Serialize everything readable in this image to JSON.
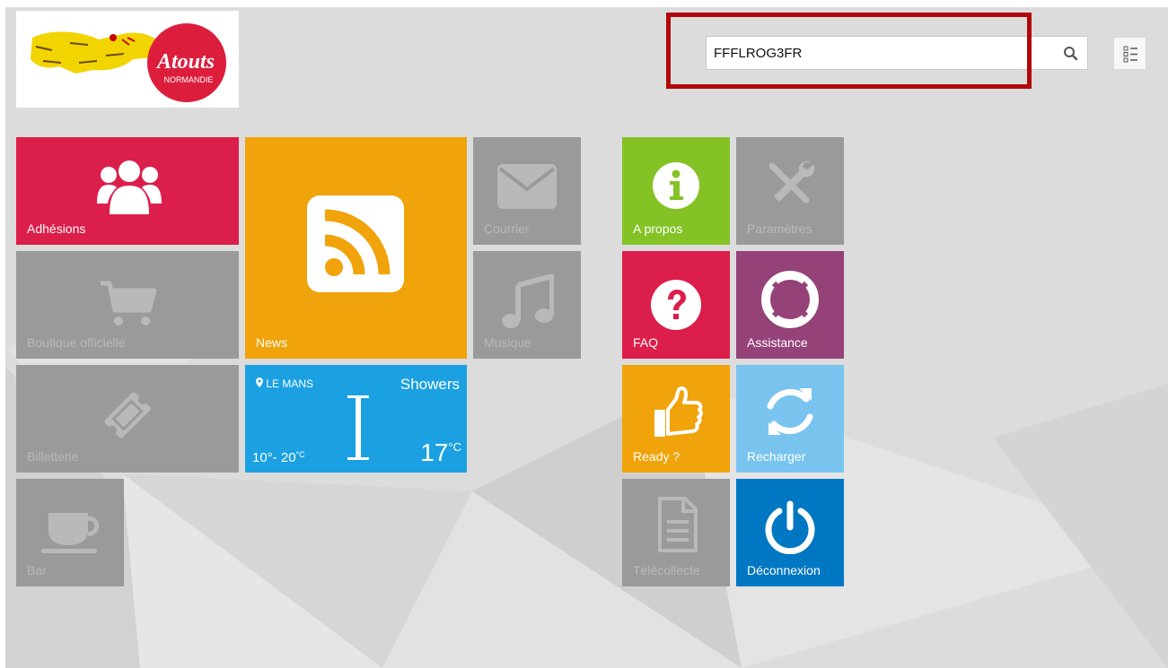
{
  "logo": {
    "brand": "Atouts",
    "sub": "NORMANDIE"
  },
  "search": {
    "value": "FFFLROG3FR",
    "icon": "search-icon"
  },
  "menu": {
    "icon": "list-icon"
  },
  "tiles": {
    "adhesions": {
      "label": "Adhésions",
      "color": "#dc1e4b",
      "icon": "users-icon"
    },
    "news": {
      "label": "News",
      "color": "#f0a30a",
      "icon": "rss-icon"
    },
    "courrier": {
      "label": "Courrier",
      "color": "#9a9a9a",
      "icon": "envelope-icon"
    },
    "boutique": {
      "label": "Boutique officielle",
      "color": "#9a9a9a",
      "icon": "cart-icon"
    },
    "musique": {
      "label": "Musique",
      "color": "#9a9a9a",
      "icon": "music-icon"
    },
    "billetterie": {
      "label": "Billetterie",
      "color": "#9a9a9a",
      "icon": "ticket-icon"
    },
    "bar": {
      "label": "Bar",
      "color": "#9a9a9a",
      "icon": "coffee-cup-icon"
    },
    "apropos": {
      "label": "A propos",
      "color": "#84c225",
      "icon": "info-icon"
    },
    "parametres": {
      "label": "Paramètres",
      "color": "#9a9a9a",
      "icon": "tools-icon"
    },
    "faq": {
      "label": "FAQ",
      "color": "#dc1e4b",
      "icon": "question-icon"
    },
    "assistance": {
      "label": "Assistance",
      "color": "#954279",
      "icon": "lifebuoy-icon"
    },
    "ready": {
      "label": "Ready ?",
      "color": "#f0a30a",
      "icon": "thumbs-up-icon"
    },
    "recharger": {
      "label": "Recharger",
      "color": "#78c4ef",
      "icon": "refresh-icon"
    },
    "telecollecte": {
      "label": "Télécollecte",
      "color": "#9a9a9a",
      "icon": "document-icon"
    },
    "deconnexion": {
      "label": "Déconnexion",
      "color": "#0077c2",
      "icon": "power-icon"
    }
  },
  "weather": {
    "location": "LE MANS",
    "condition": "Showers",
    "range_low": "10",
    "range_high": "20",
    "temp": "17",
    "unit": "°C",
    "color": "#1ba1e2",
    "icon": "showers-icon"
  }
}
